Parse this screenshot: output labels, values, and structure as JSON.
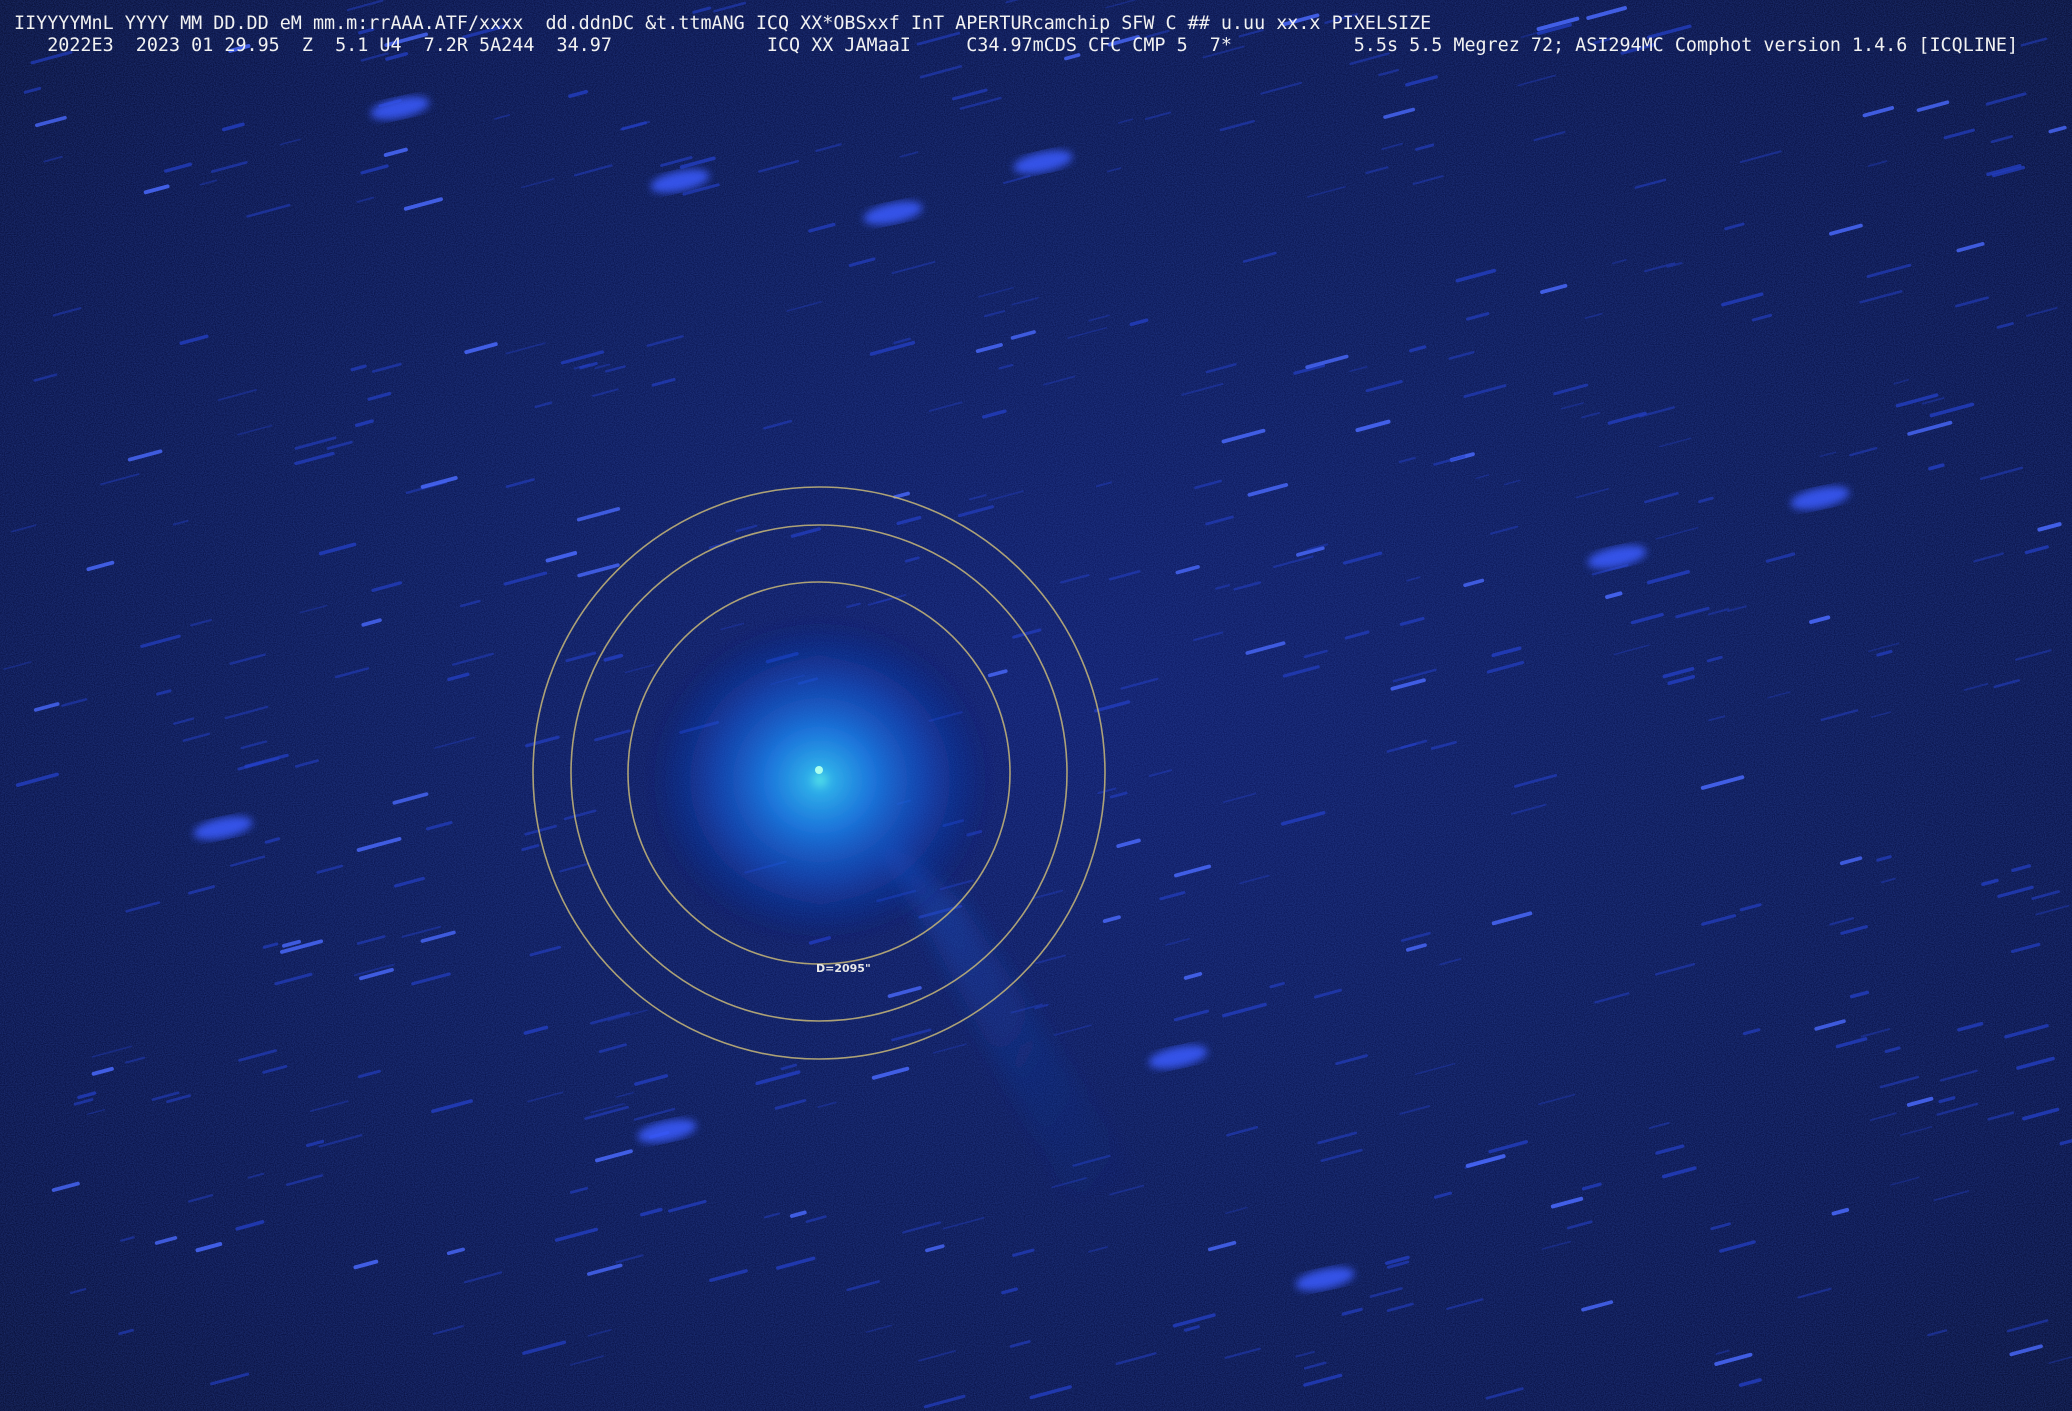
{
  "header": {
    "line1": "IIYYYYMnL YYYY MM DD.DD eM mm.m:rrAAA.ATF/xxxx  dd.ddnDC &t.ttmANG ICQ XX*OBSxxf InT APERTURcamchip SFW C ## u.uu xx.x PIXELSIZE",
    "line2": "   2022E3  2023 01 29.95  Z  5.1 U4  7.2R 5A244  34.97              ICQ XX JAMaaI     C34.97mCDS CFC CMP 5  7*           5.5s 5.5 Megrez 72; ASI294MC Comphot version 1.4.6 [ICQLINE]"
  },
  "aperture": {
    "label": "D=2095\""
  },
  "colors": {
    "sky": "#061048",
    "coma": "#2a7cf0",
    "nucleus": "#7ff5e0",
    "rings": "#c8b878",
    "stars": "#3d5cff",
    "text": "#f2f2f2"
  }
}
